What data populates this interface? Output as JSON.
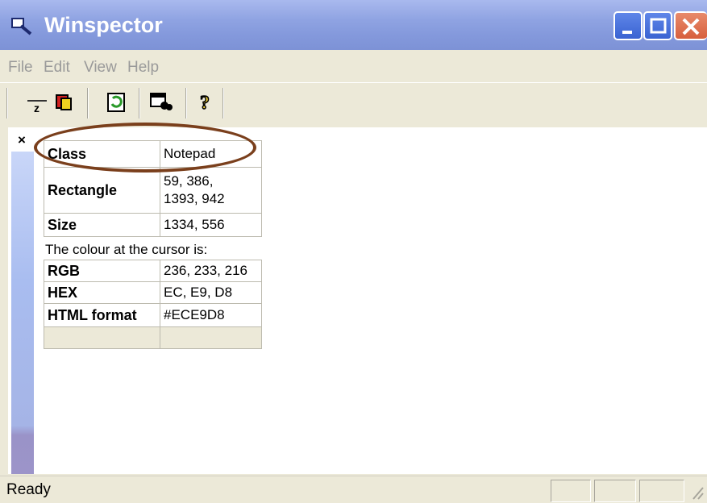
{
  "window": {
    "title": "Winspector"
  },
  "menu": {
    "items": [
      "File",
      "Edit",
      "View",
      "Help"
    ]
  },
  "panel": {
    "close": "×"
  },
  "info_table": {
    "rows": [
      {
        "key": "Class",
        "value": "Notepad"
      },
      {
        "key": "Rectangle",
        "value": "59, 386,",
        "value2": "1393, 942"
      },
      {
        "key": "Size",
        "value": "1334, 556"
      }
    ]
  },
  "colour_caption": "The colour at the cursor is:",
  "colour_table": {
    "rows": [
      {
        "key": "RGB",
        "value": "236, 233, 216"
      },
      {
        "key": "HEX",
        "value": "EC, E9, D8"
      },
      {
        "key": "HTML format",
        "value": "#ECE9D8"
      },
      {
        "key": "",
        "value": ""
      }
    ]
  },
  "status": {
    "text": "Ready"
  },
  "colors": {
    "title_bar": "#8fa3e2",
    "annotation": "#7a3f1c",
    "background": "#ece9d8"
  }
}
